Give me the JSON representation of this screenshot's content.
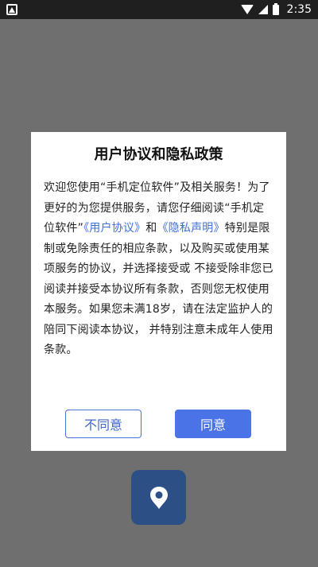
{
  "status_bar": {
    "time": "2:35",
    "icons": [
      "app-notification-icon",
      "wifi-icon",
      "signal-icon",
      "battery-icon"
    ]
  },
  "app_icon": {
    "name": "location-pin-icon",
    "color": "#2c4f86"
  },
  "dialog": {
    "title": "用户协议和隐私政策",
    "body": {
      "text_1": "欢迎您使用“手机定位软件”及相关服务！为了更好的为您提供服务，请您仔细阅读“手机定位软件”",
      "link_user_agreement": "《用户协议》",
      "text_2": "和",
      "link_privacy": "《隐私声明》",
      "text_3": "特别是限制或免除责任的相应条款，以及购买或使用某项服务的协议，并选择接受或 不接受除非您已阅读并接受本协议所有条款，否则您无权使用本服务。如果您未满18岁，请在法定监护人的陪同下阅读本协议， 并特别注意未成年人使用条款。"
    },
    "buttons": {
      "disagree": "不同意",
      "agree": "同意"
    }
  },
  "colors": {
    "overlay": "#6f6f6f",
    "link": "#3d6fe0",
    "primary": "#4a73e8"
  }
}
